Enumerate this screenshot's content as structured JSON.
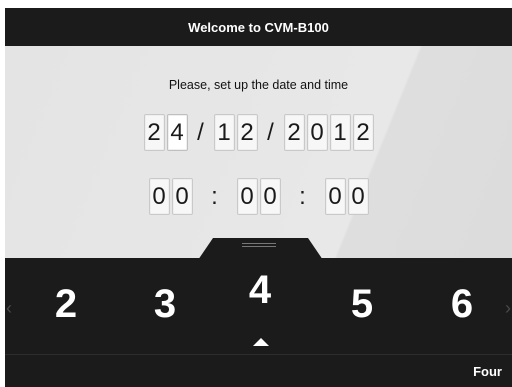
{
  "title": "Welcome to CVM-B100",
  "prompt": "Please, set up the date and time",
  "date": {
    "day": [
      "2",
      "4"
    ],
    "month": [
      "1",
      "2"
    ],
    "year": [
      "2",
      "0",
      "1",
      "2"
    ],
    "separator": "/"
  },
  "time": {
    "hours": [
      "0",
      "0"
    ],
    "minutes": [
      "0",
      "0"
    ],
    "seconds": [
      "0",
      "0"
    ],
    "separator": ":"
  },
  "picker": {
    "values": [
      "2",
      "3",
      "4",
      "5",
      "6"
    ],
    "selected_value": "4",
    "left_arrow": "‹",
    "right_arrow": "›"
  },
  "footer": {
    "selected_label": "Four"
  }
}
